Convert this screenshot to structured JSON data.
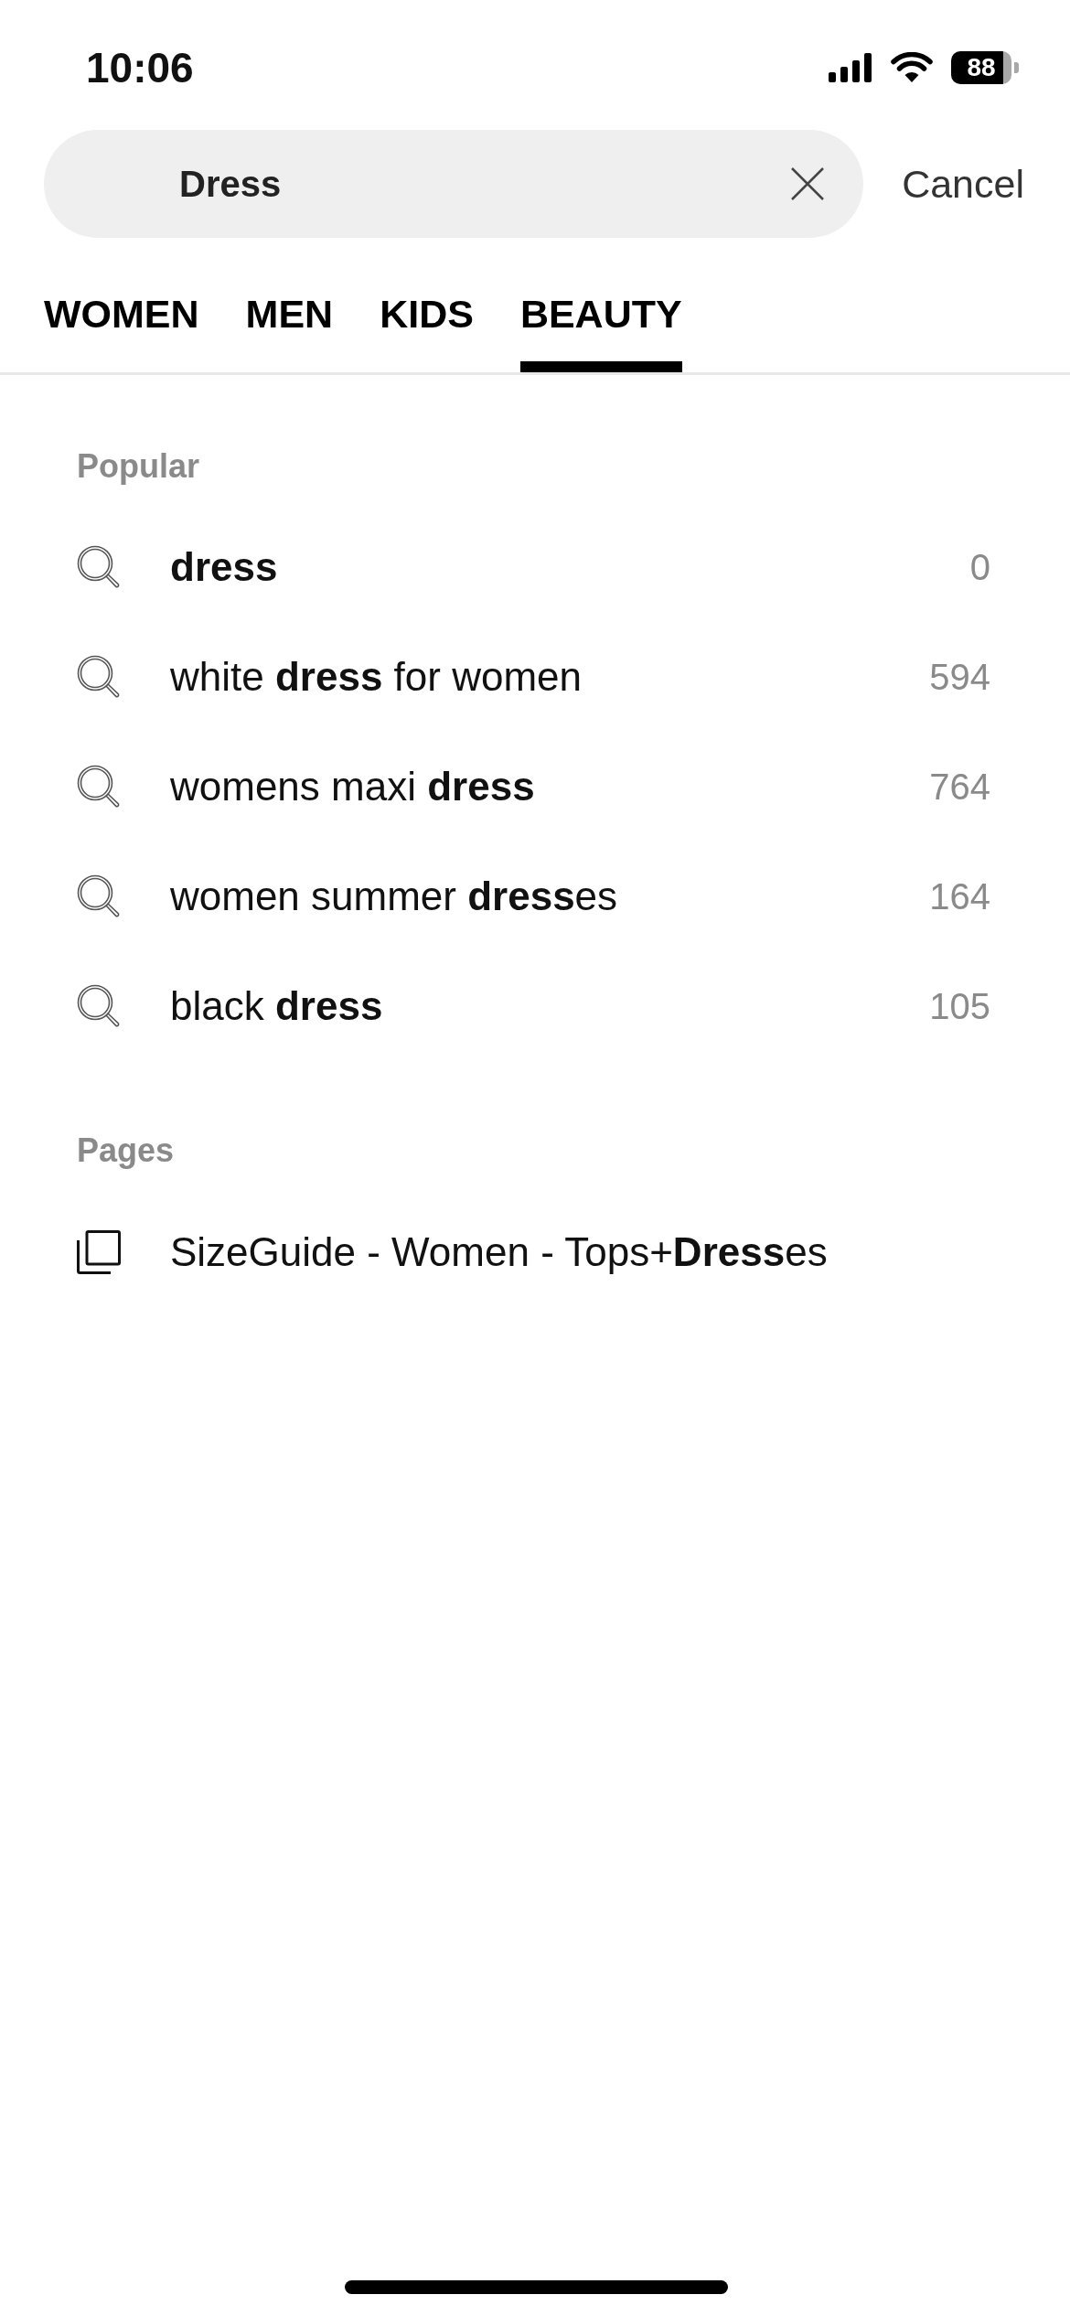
{
  "status_bar": {
    "time": "10:06",
    "battery": "88"
  },
  "search": {
    "value": "Dress",
    "cancel_label": "Cancel"
  },
  "tabs": [
    {
      "label": "WOMEN",
      "selected": false
    },
    {
      "label": "MEN",
      "selected": false
    },
    {
      "label": "KIDS",
      "selected": false
    },
    {
      "label": "BEAUTY",
      "selected": true
    }
  ],
  "popular": {
    "title": "Popular",
    "items": [
      {
        "text": "**dress**",
        "count": "0"
      },
      {
        "text": "white **dress** for women",
        "count": "594"
      },
      {
        "text": "womens maxi **dress**",
        "count": "764"
      },
      {
        "text": "women summer **dress**es",
        "count": "164"
      },
      {
        "text": "black **dress**",
        "count": "105"
      }
    ]
  },
  "pages": {
    "title": "Pages",
    "items": [
      {
        "text": "SizeGuide - Women - Tops+**Dress**es"
      }
    ]
  }
}
